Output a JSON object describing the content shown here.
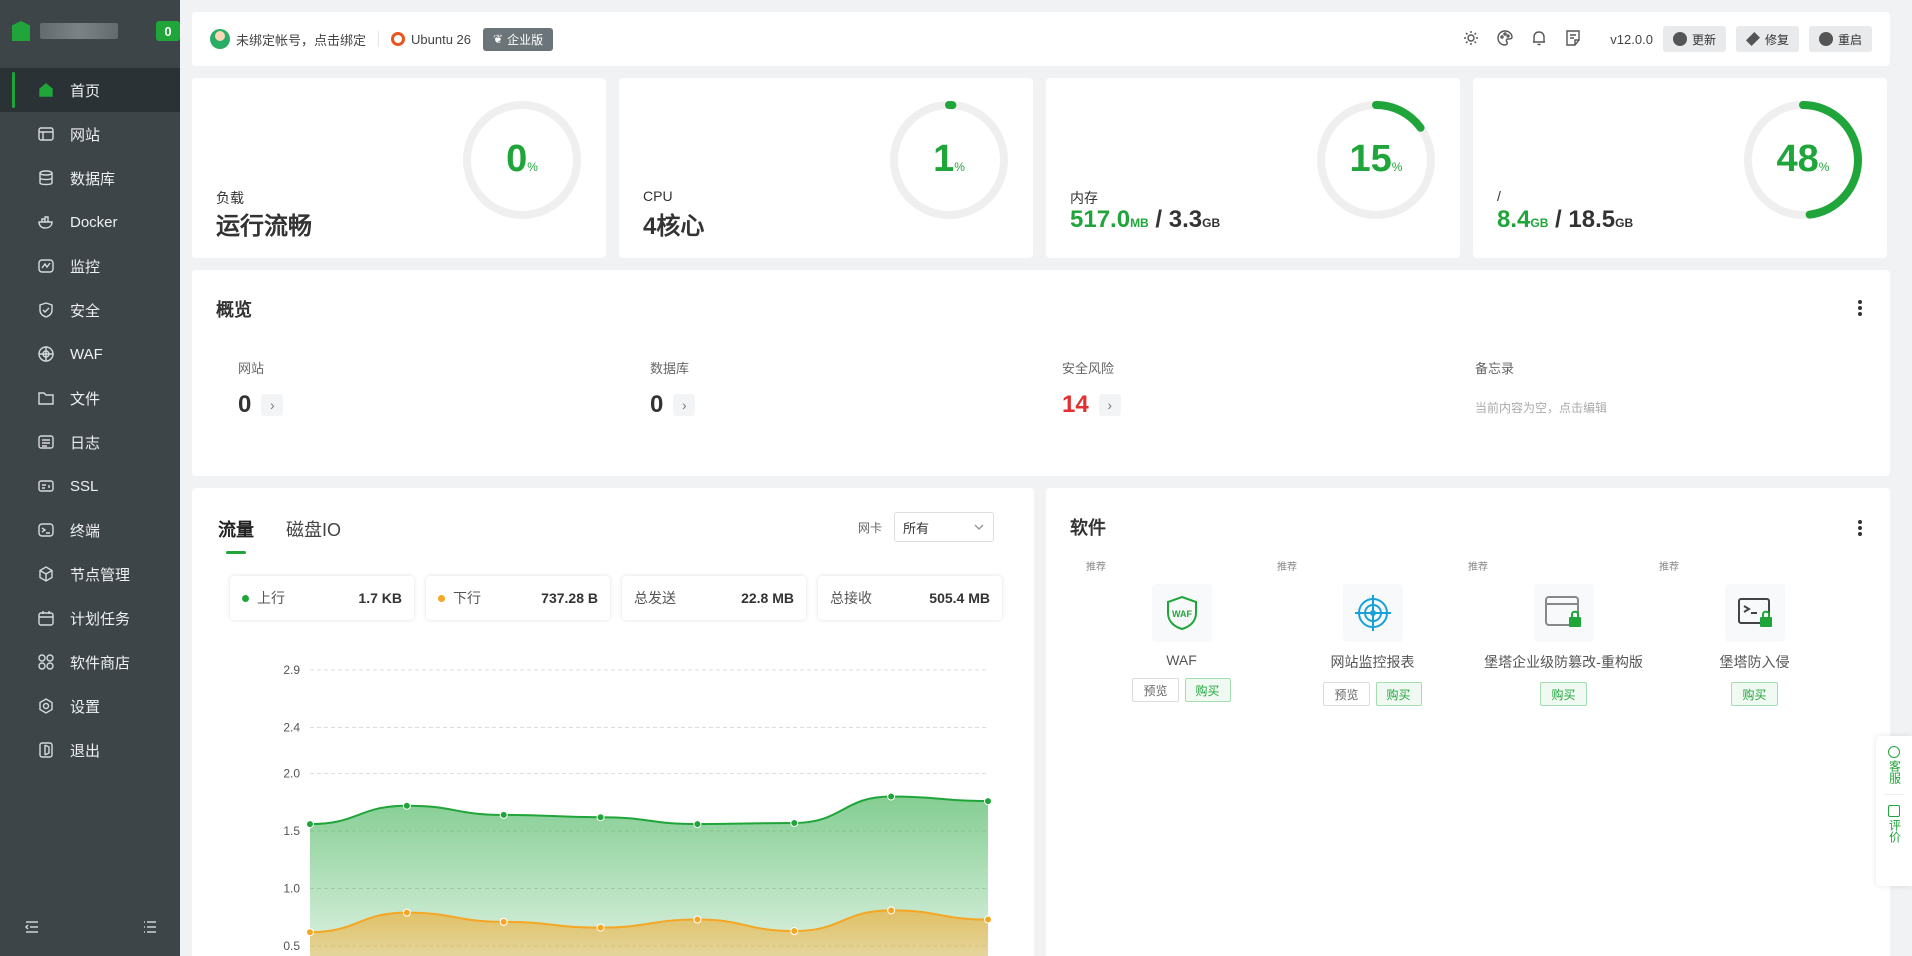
{
  "brand": {
    "badge": "0"
  },
  "sidebar": {
    "items": [
      {
        "label": "首页",
        "icon": "home-icon",
        "active": true
      },
      {
        "label": "网站",
        "icon": "website-icon"
      },
      {
        "label": "数据库",
        "icon": "database-icon"
      },
      {
        "label": "Docker",
        "icon": "docker-icon"
      },
      {
        "label": "监控",
        "icon": "monitor-icon"
      },
      {
        "label": "安全",
        "icon": "shield-icon"
      },
      {
        "label": "WAF",
        "icon": "waf-icon"
      },
      {
        "label": "文件",
        "icon": "folder-icon"
      },
      {
        "label": "日志",
        "icon": "log-icon"
      },
      {
        "label": "SSL",
        "icon": "ssl-icon"
      },
      {
        "label": "终端",
        "icon": "terminal-icon"
      },
      {
        "label": "节点管理",
        "icon": "node-icon"
      },
      {
        "label": "计划任务",
        "icon": "calendar-icon"
      },
      {
        "label": "软件商店",
        "icon": "store-icon"
      },
      {
        "label": "设置",
        "icon": "gear-icon"
      },
      {
        "label": "退出",
        "icon": "logout-icon"
      }
    ]
  },
  "header": {
    "account": "未绑定帐号，点击绑定",
    "os": "Ubuntu 26",
    "edition": "企业版",
    "version": "v12.0.0",
    "update_label": "更新",
    "repair_label": "修复",
    "restart_label": "重启"
  },
  "stats": {
    "load": {
      "label": "负载",
      "value": "运行流畅",
      "percent": "0",
      "fraction": 0
    },
    "cpu": {
      "label": "CPU",
      "value": "4核心",
      "percent": "1",
      "fraction": 0.01
    },
    "memory": {
      "label": "内存",
      "used": "517.0",
      "used_unit": "MB",
      "total": "3.3",
      "total_unit": "GB",
      "percent": "15",
      "fraction": 0.15
    },
    "disk": {
      "label": "/",
      "used": "8.4",
      "used_unit": "GB",
      "total": "18.5",
      "total_unit": "GB",
      "percent": "48",
      "fraction": 0.48
    },
    "percent_unit": "%"
  },
  "overview": {
    "title": "概览",
    "sites": {
      "label": "网站",
      "value": "0"
    },
    "databases": {
      "label": "数据库",
      "value": "0"
    },
    "risks": {
      "label": "安全风险",
      "value": "14"
    },
    "memo": {
      "label": "备忘录",
      "placeholder": "当前内容为空，点击编辑"
    }
  },
  "traffic": {
    "tabs": [
      "流量",
      "磁盘IO"
    ],
    "nic_label": "网卡",
    "nic_value": "所有",
    "up": {
      "label": "上行",
      "value": "1.7 KB"
    },
    "down": {
      "label": "下行",
      "value": "737.28 B"
    },
    "sent": {
      "label": "总发送",
      "value": "22.8 MB"
    },
    "recv": {
      "label": "总接收",
      "value": "505.4 MB"
    }
  },
  "chart_data": {
    "type": "area",
    "yticks": [
      "2.9",
      "2.4",
      "2.0",
      "1.5",
      "1.0",
      "0.5"
    ],
    "ylim": [
      0.5,
      2.9
    ],
    "grid": true,
    "series": [
      {
        "color": "#20a53a",
        "values": [
          1.56,
          1.72,
          1.64,
          1.62,
          1.56,
          1.57,
          1.8,
          1.76
        ]
      },
      {
        "color": "#f5a623",
        "values": [
          0.62,
          0.79,
          0.71,
          0.66,
          0.73,
          0.63,
          0.81,
          0.73
        ]
      }
    ]
  },
  "software": {
    "title": "软件",
    "items": [
      {
        "tag": "推荐",
        "name": "WAF",
        "icon": "waf-shield-icon",
        "preview": "预览",
        "buy": "购买"
      },
      {
        "tag": "推荐",
        "name": "网站监控报表",
        "icon": "target-icon",
        "preview": "预览",
        "buy": "购买"
      },
      {
        "tag": "推荐",
        "name": "堡塔企业级防篡改-重构版",
        "icon": "lock-window-icon",
        "buy": "购买"
      },
      {
        "tag": "推荐",
        "name": "堡塔防入侵",
        "icon": "terminal-lock-icon",
        "buy": "购买"
      }
    ]
  },
  "float": {
    "service": "客服",
    "rate": "评价"
  },
  "colors": {
    "accent": "#20a53a",
    "danger": "#e03030",
    "orange": "#f5a623",
    "sidebar": "#3d4549"
  }
}
